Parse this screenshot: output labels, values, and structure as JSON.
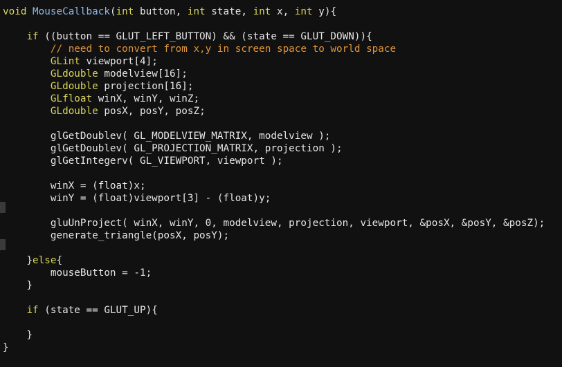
{
  "colors": {
    "background": "#111111",
    "plain": "#e6e6e6",
    "keyword": "#d8d45a",
    "function_name": "#8fb8e8",
    "comment": "#e09438"
  },
  "code": {
    "l1": {
      "a": "void",
      "b": " ",
      "c": "MouseCallback",
      "d": "(",
      "e": "int",
      "f": " button, ",
      "g": "int",
      "h": " state, ",
      "i": "int",
      "j": " x, ",
      "k": "int",
      "m": " y){"
    },
    "l2": "",
    "l3": {
      "a": "    ",
      "b": "if",
      "c": " ((button == GLUT_LEFT_BUTTON) && (state == GLUT_DOWN)){"
    },
    "l4": {
      "a": "        ",
      "b": "// need to convert from x,y in screen space to world space"
    },
    "l5": {
      "a": "        ",
      "b": "GLint",
      "c": " viewport[4];"
    },
    "l6": {
      "a": "        ",
      "b": "GLdouble",
      "c": " modelview[16];"
    },
    "l7": {
      "a": "        ",
      "b": "GLdouble",
      "c": " projection[16];"
    },
    "l8": {
      "a": "        ",
      "b": "GLfloat",
      "c": " winX, winY, winZ;"
    },
    "l9": {
      "a": "        ",
      "b": "GLdouble",
      "c": " posX, posY, posZ;"
    },
    "l10": "",
    "l11": "        glGetDoublev( GL_MODELVIEW_MATRIX, modelview );",
    "l12": "        glGetDoublev( GL_PROJECTION_MATRIX, projection );",
    "l13": "        glGetIntegerv( GL_VIEWPORT, viewport );",
    "l14": "",
    "l15": "        winX = (float)x;",
    "l16": "        winY = (float)viewport[3] - (float)y;",
    "l17": "",
    "l18": "        gluUnProject( winX, winY, 0, modelview, projection, viewport, &posX, &posY, &posZ);",
    "l19": "        generate_triangle(posX, posY);",
    "l20": "",
    "l21": {
      "a": "    }",
      "b": "else",
      "c": "{"
    },
    "l22": "        mouseButton = -1;",
    "l23": "    }",
    "l24": "",
    "l25": {
      "a": "    ",
      "b": "if",
      "c": " (state == GLUT_UP){"
    },
    "l26": "",
    "l27": "    }",
    "l28": "}"
  }
}
